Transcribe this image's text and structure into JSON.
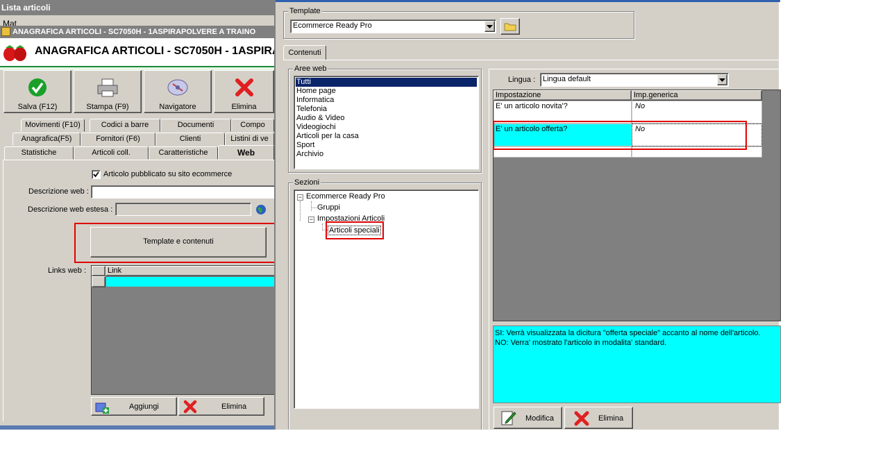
{
  "lista_window": {
    "title": "Lista articoli",
    "row_text": "Mat"
  },
  "anagrafica_window": {
    "titlebar": "ANAGRAFICA ARTICOLI - SC7050H - 1ASPIRAPOLVERE A TRAINO",
    "header": "ANAGRAFICA ARTICOLI - SC7050H - 1ASPIRA",
    "toolbar": {
      "save": "Salva (F12)",
      "print": "Stampa (F9)",
      "navigator": "Navigatore",
      "delete": "Elimina"
    },
    "tabs_row1": [
      "Movimenti (F10)",
      "Codici a barre",
      "Documenti",
      "Compo"
    ],
    "tabs_row2": [
      "Anagrafica(F5)",
      "Fornitori (F6)",
      "Clienti",
      "Listini di ve"
    ],
    "tabs_row3": [
      "Statistiche",
      "Articoli coll.",
      "Caratteristiche",
      "Web"
    ],
    "web": {
      "published_label": "Articolo pubblicato su sito ecommerce",
      "desc_label": "Descrizione web :",
      "desc_ext_label": "Descrizione web estesa :",
      "template_button": "Template e contenuti",
      "links_label": "Links web :",
      "links_header": "Link",
      "add_button": "Aggiungi",
      "delete_button": "Elimina"
    }
  },
  "template_window": {
    "template_group": "Template",
    "template_value": "Ecommerce Ready Pro",
    "tab_contenuti": "Contenuti",
    "aree_group": "Aree web",
    "aree": [
      "Tutti",
      "Home page",
      "Informatica",
      "Telefonia",
      "Audio & Video",
      "Videogiochi",
      "Articoli per la casa",
      "Sport",
      "Archivio"
    ],
    "sezioni_group": "Sezioni",
    "tree": {
      "root": "Ecommerce Ready Pro",
      "child1": "Gruppi",
      "child2": "Impostazioni Articoli",
      "grandchild": "Articoli speciali"
    },
    "lingua_label": "Lingua :",
    "lingua_value": "Lingua default",
    "grid_headers": [
      "Impostazione",
      "Imp.generica"
    ],
    "grid_rows": [
      {
        "setting": "E' un articolo novita'?",
        "value": "No"
      },
      {
        "setting": "E' un articolo offerta?",
        "value": "No"
      }
    ],
    "description_line1": "SI: Verrà visualizzata la dicitura \"offerta speciale\" accanto al nome dell'articolo.",
    "description_line2": "NO: Verra' mostrato l'articolo in modalita' standard.",
    "modify_button": "Modifica",
    "delete_button": "Elimina"
  }
}
